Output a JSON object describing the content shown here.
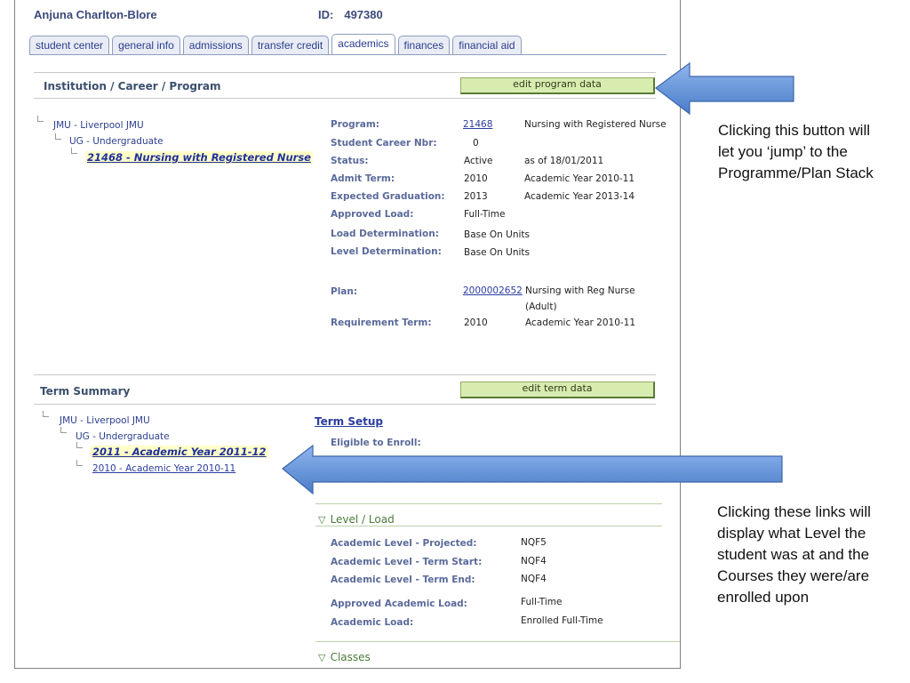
{
  "header": {
    "name": "Anjuna Charlton-Blore",
    "id_label": "ID:",
    "id_value": "497380"
  },
  "tabs": [
    {
      "label": "student center"
    },
    {
      "label": "general info"
    },
    {
      "label": "admissions"
    },
    {
      "label": "transfer credit"
    },
    {
      "label": "academics"
    },
    {
      "label": "finances"
    },
    {
      "label": "financial aid"
    }
  ],
  "program_section": {
    "title": "Institution / Career / Program",
    "edit_button": "edit program data",
    "tree": {
      "institution": "JMU - Liverpool JMU",
      "career": "UG - Undergraduate",
      "program": "21468 - Nursing with Registered Nurse"
    },
    "fields": {
      "program_label": "Program:",
      "program_code": "21468",
      "program_desc": "Nursing with Registered Nurse",
      "career_nbr_label": "Student Career Nbr:",
      "career_nbr": "0",
      "status_label": "Status:",
      "status": "Active",
      "status_date": "as of 18/01/2011",
      "admit_label": "Admit Term:",
      "admit_term": "2010",
      "admit_desc": "Academic Year 2010-11",
      "grad_label": "Expected Graduation:",
      "grad_term": "2013",
      "grad_desc": "Academic Year 2013-14",
      "load_label": "Approved Load:",
      "load": "Full-Time",
      "load_det_label": "Load Determination:",
      "load_det": "Base On Units",
      "level_det_label": "Level Determination:",
      "level_det": "Base On Units",
      "plan_label": "Plan:",
      "plan_code": "2000002652",
      "plan_desc1": "Nursing with Reg Nurse",
      "plan_desc2": "(Adult)",
      "req_label": "Requirement Term:",
      "req_term": "2010",
      "req_desc": "Academic Year 2010-11"
    }
  },
  "term_section": {
    "title": "Term Summary",
    "edit_button": "edit term data",
    "tree": {
      "institution": "JMU - Liverpool JMU",
      "career": "UG - Undergraduate",
      "term1": "2011 - Academic Year 2011-12",
      "term2": "2010 - Academic Year 2010-11"
    },
    "term_setup": "Term Setup",
    "eligible_label": "Eligible to Enroll:",
    "level_load": {
      "title": "Level / Load",
      "projected_label": "Academic Level - Projected:",
      "projected": "NQF5",
      "start_label": "Academic Level - Term Start:",
      "start": "NQF4",
      "end_label": "Academic Level - Term End:",
      "end": "NQF4",
      "approved_label": "Approved Academic Load:",
      "approved": "Full-Time",
      "acad_load_label": "Academic Load:",
      "acad_load": "Enrolled Full-Time"
    },
    "classes_title": "Classes"
  },
  "annotations": {
    "note1": "Clicking this button will let you ‘jump’ to the Programme/Plan Stack",
    "note2": "Clicking these links will display what Level the student was at and the Courses they were/are enrolled upon"
  },
  "colors": {
    "arrow": "#5b8fd8",
    "button": "#d8ecb0",
    "highlight": "#ffffc8"
  }
}
